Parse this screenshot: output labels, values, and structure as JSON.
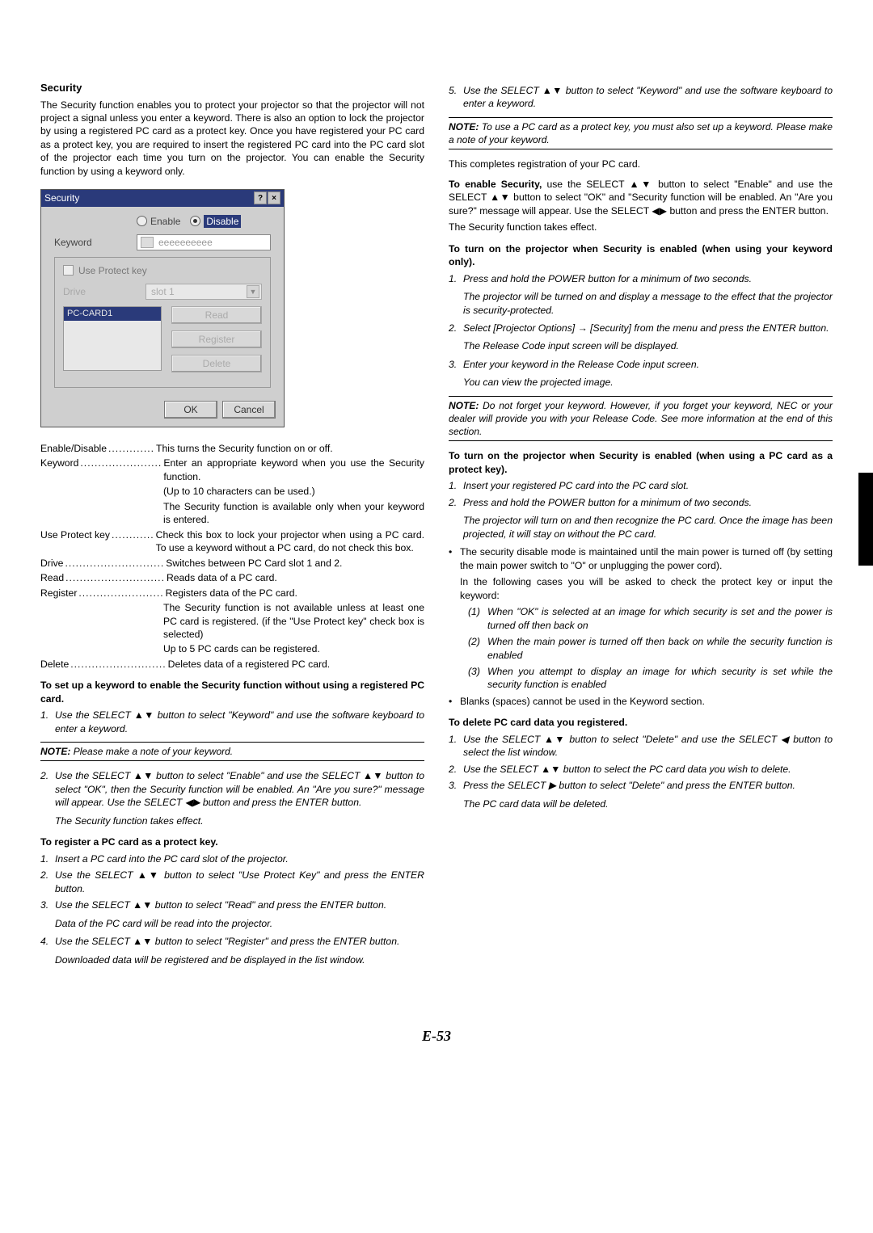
{
  "page_number": "E-53",
  "left": {
    "heading": "Security",
    "intro": "The Security function enables you to protect your projector so that the projector will not project a signal unless you enter a keyword. There is also an option to lock the projector by using a registered PC card as a protect key. Once you have registered your PC card as a protect key, you are required to insert the registered PC card into the PC card slot of the projector each time you turn on the projector. You can enable the Security function by using a keyword only.",
    "dialog": {
      "title": "Security",
      "help": "?",
      "close": "×",
      "enable": "Enable",
      "disable": "Disable",
      "keyword_label": "Keyword",
      "keyword_value": "eeeeeeeeee",
      "use_protect": "Use Protect key",
      "drive_label": "Drive",
      "drive_value": "slot 1",
      "list_item": "PC-CARD1",
      "btn_read": "Read",
      "btn_register": "Register",
      "btn_delete": "Delete",
      "ok": "OK",
      "cancel": "Cancel"
    },
    "defs": {
      "enable_t": "Enable/Disable",
      "enable_d": "This turns the Security function on or off.",
      "keyword_t": "Keyword",
      "keyword_d": "Enter an appropriate keyword when you use the Security function.",
      "keyword_d2": "(Up to 10 characters can be used.)",
      "keyword_d3": "The Security function is available only when your keyword is entered.",
      "upk_t": "Use Protect key",
      "upk_d": "Check this box to lock your projector when using a PC card. To use a keyword without a PC card, do not check this box.",
      "drive_t": "Drive",
      "drive_d": "Switches between PC Card slot 1 and 2.",
      "read_t": "Read",
      "read_d": "Reads data of a PC card.",
      "register_t": "Register",
      "register_d": "Registers data of the PC card.",
      "register_d2": "The Security function is not available unless at least one PC card is registered. (if the \"Use Protect key\" check box is selected)",
      "register_d3": "Up to 5 PC cards can be registered.",
      "delete_t": "Delete",
      "delete_d": "Deletes data of a registered PC card."
    },
    "setup_heading": "To set up a keyword to enable the Security function without using a registered PC card.",
    "setup1": "Use the SELECT ▲▼ button to select \"Keyword\" and use the software keyboard to enter a keyword.",
    "note1": "Please make a note of your keyword.",
    "setup2": "Use the SELECT ▲▼ button to select \"Enable\" and use the SELECT ▲▼ button to select \"OK\", then the Security function will be enabled. An \"Are you sure?\" message will appear. Use the SELECT ◀▶ button and press the ENTER button.",
    "setup2b": "The Security function takes effect.",
    "reg_heading": "To register a PC card as a protect key.",
    "reg1": "Insert a PC card into the PC card slot of the projector.",
    "reg2": "Use the SELECT ▲▼ button to select \"Use Protect Key\" and press the ENTER button.",
    "reg3": "Use the SELECT ▲▼ button to select \"Read\" and press the ENTER button.",
    "reg3b": "Data of the PC card will be read into the projector.",
    "reg4": "Use the SELECT ▲▼ button to select \"Register\" and press the ENTER button.",
    "reg4b": "Downloaded data will be registered and be displayed in the list window."
  },
  "right": {
    "reg5": "Use the SELECT ▲▼ button to select \"Keyword\" and use the software keyboard to enter a keyword.",
    "note2": "To use a PC card as a protect key, you must also set up a keyword. Please make a note of your keyword.",
    "completes": "This completes registration of your PC card.",
    "enable_para": "use the SELECT ▲▼ button to select \"Enable\" and use the SELECT ▲▼ button to select \"OK\" and \"Security function will be enabled. An \"Are you sure?\" message will appear. Use the SELECT ◀▶ button and press the ENTER button.",
    "enable_lead": "To enable Security,",
    "enable_para2": "The Security function takes effect.",
    "turnon_kw_heading": "To turn on the projector when Security is enabled (when using your keyword only).",
    "tk1": "Press and hold the POWER button for a minimum of two seconds.",
    "tk1b": "The projector will be turned on and display a message to the effect that the projector is security-protected.",
    "tk2": "Select [Projector Options] → [Security] from the menu and press the ENTER button.",
    "tk2b": "The Release Code input screen will be displayed.",
    "tk3": "Enter your keyword in the Release Code input screen.",
    "tk3b": "You can view the projected image.",
    "note3": "Do not forget your keyword. However, if you forget your keyword, NEC or your dealer will provide you with your Release Code. See more information at the end of this section.",
    "turnon_pc_heading": "To turn on the projector when Security is enabled (when using a PC card as a protect key).",
    "tp1": "Insert your registered PC card into the PC card slot.",
    "tp2": "Press and hold the POWER button for a minimum of two seconds.",
    "tp2b": "The projector will turn on and then recognize the PC card. Once the image has been projected, it will stay on without the PC card.",
    "bul1": "The security disable mode is maintained until the main power is turned off (by setting the main power switch to \"O\" or unplugging the power cord).",
    "bul1b": "In the following cases you will be asked to check the protect key or input the keyword:",
    "c1": "When \"OK\" is selected at an image for which security is set and the power is turned off then back on",
    "c2": "When the main power is turned off then back on while the security function is enabled",
    "c3": "When you attempt to display an image for which security is set while the security function is enabled",
    "bul2": "Blanks (spaces) cannot be used in the Keyword section.",
    "del_heading": "To delete PC card data you registered.",
    "d1": "Use the SELECT ▲▼ button to select \"Delete\" and use the SELECT ◀ button to select the list window.",
    "d2": "Use the SELECT ▲▼ button to select the PC card data you wish to delete.",
    "d3": "Press the SELECT ▶ button to select \"Delete\" and press the ENTER button.",
    "d3b": "The PC card data will be deleted.",
    "note_label": "NOTE:"
  }
}
